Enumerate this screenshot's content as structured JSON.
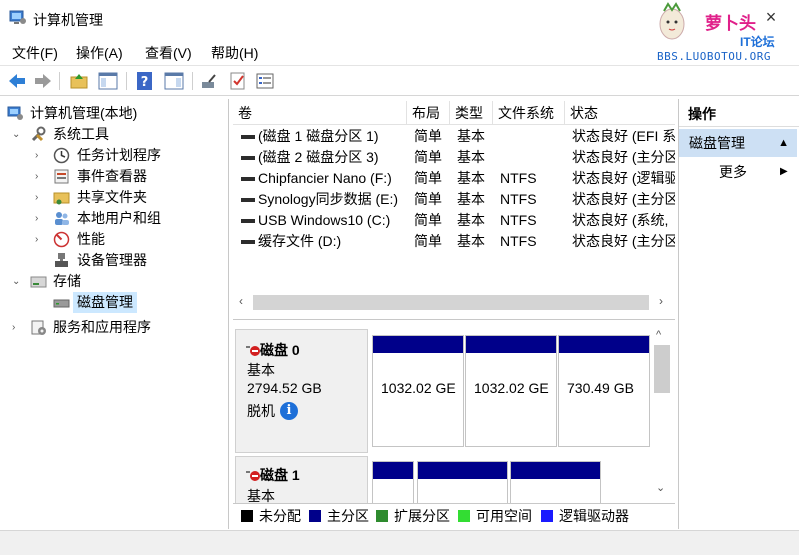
{
  "window": {
    "title": "计算机管理",
    "close_glyph": "×"
  },
  "watermark": {
    "title": "萝卜头",
    "sub": "IT论坛",
    "url": "BBS.LUOBOTOU.ORG"
  },
  "menu": [
    {
      "label": "文件(F)"
    },
    {
      "label": "操作(A)"
    },
    {
      "label": "查看(V)"
    },
    {
      "label": "帮助(H)"
    }
  ],
  "toolbar": {
    "buttons": [
      "back-icon",
      "forward-icon",
      "up-folder-icon",
      "show-hide-tree-icon",
      "help-icon",
      "show-action-pane-icon",
      "connect-icon",
      "check-icon",
      "properties-icon"
    ]
  },
  "tree": {
    "root": "计算机管理(本地)",
    "system_tools": "系统工具",
    "task_scheduler": "任务计划程序",
    "event_viewer": "事件查看器",
    "shared_folders": "共享文件夹",
    "local_users": "本地用户和组",
    "performance": "性能",
    "device_manager": "设备管理器",
    "storage": "存储",
    "disk_management": "磁盘管理",
    "services": "服务和应用程序"
  },
  "volume_list": {
    "columns": [
      "卷",
      "布局",
      "类型",
      "文件系统",
      "状态"
    ],
    "rows": [
      {
        "volume": "(磁盘 1 磁盘分区 1)",
        "layout": "简单",
        "type": "基本",
        "fs": "",
        "status": "状态良好 (EFI 系"
      },
      {
        "volume": "(磁盘 2 磁盘分区 3)",
        "layout": "简单",
        "type": "基本",
        "fs": "",
        "status": "状态良好 (主分区"
      },
      {
        "volume": "Chipfancier Nano (F:)",
        "layout": "简单",
        "type": "基本",
        "fs": "NTFS",
        "status": "状态良好 (逻辑驱"
      },
      {
        "volume": "Synology同步数据 (E:)",
        "layout": "简单",
        "type": "基本",
        "fs": "NTFS",
        "status": "状态良好 (主分区"
      },
      {
        "volume": "USB Windows10 (C:)",
        "layout": "简单",
        "type": "基本",
        "fs": "NTFS",
        "status": "状态良好 (系统,"
      },
      {
        "volume": "缓存文件 (D:)",
        "layout": "简单",
        "type": "基本",
        "fs": "NTFS",
        "status": "状态良好 (主分区"
      }
    ],
    "scroll_left": "‹",
    "scroll_right": "›"
  },
  "disks": [
    {
      "name": "磁盘 0",
      "type": "基本",
      "size": "2794.52 GB",
      "state": "脱机",
      "info_glyph": "i",
      "partitions": [
        "1032.02 GE",
        "1032.02 GE",
        "730.49 GB"
      ]
    },
    {
      "name": "磁盘 1",
      "type": "基本"
    }
  ],
  "disk_scroll": {
    "up": "^",
    "down": "⌄"
  },
  "legend": [
    {
      "label": "未分配",
      "color": "#000000"
    },
    {
      "label": "主分区",
      "color": "#00008a"
    },
    {
      "label": "扩展分区",
      "color": "#2e8b2e"
    },
    {
      "label": "可用空间",
      "color": "#33dd33"
    },
    {
      "label": "逻辑驱动器",
      "color": "#1a1aff"
    }
  ],
  "actions": {
    "title": "操作",
    "section": "磁盘管理",
    "more": "更多",
    "collapse_glyph": "▲",
    "more_glyph": "▶"
  }
}
